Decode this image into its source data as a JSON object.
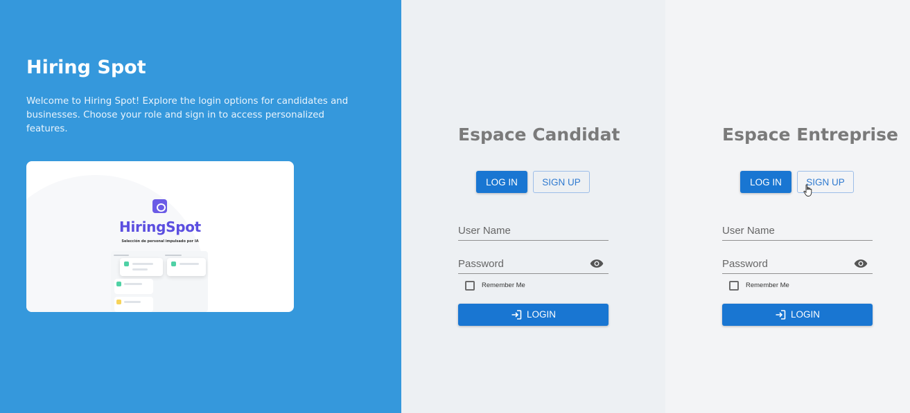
{
  "hero": {
    "title": "Hiring Spot",
    "description": "Welcome to Hiring Spot! Explore the login options for candidates and businesses. Choose your role and sign in to access personalized features.",
    "preview": {
      "brand": "HiringSpot",
      "tagline": "Selección de personal impulsado por IA",
      "logo_icon": "hiringspot-logo-icon"
    }
  },
  "candidat": {
    "title": "Espace Candidat",
    "login_tab": "LOG IN",
    "signup_tab": "SIGN UP",
    "username_placeholder": "User Name",
    "password_placeholder": "Password",
    "remember_label": "Remember Me",
    "login_button": "LOGIN"
  },
  "entreprise": {
    "title": "Espace Entreprise",
    "login_tab": "LOG IN",
    "signup_tab": "SIGN UP",
    "username_placeholder": "User Name",
    "password_placeholder": "Password",
    "remember_label": "Remember Me",
    "login_button": "LOGIN"
  },
  "colors": {
    "hero_bg": "#3598dc",
    "primary": "#1976d2",
    "brand_purple": "#5b4ee0"
  },
  "icons": {
    "password_toggle": "eye-icon",
    "login": "login-arrow-icon",
    "pointer": "hand-cursor-icon"
  }
}
